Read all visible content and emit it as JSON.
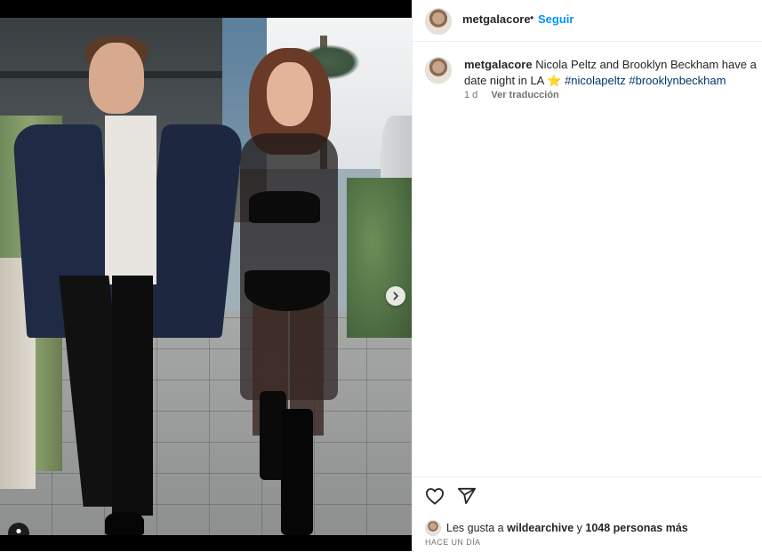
{
  "post": {
    "username": "metgalacore",
    "follow_label": "Seguir",
    "separator": "•",
    "caption_username": "metgalacore",
    "caption_text": "Nicola Peltz and Brooklyn Beckham have a date night in LA",
    "caption_emoji": "⭐",
    "hashtags": [
      "#nicolapeltz",
      "#brooklynbeckham"
    ],
    "age": "1 d",
    "translate_label": "Ver traducción",
    "likes_prefix": "Les gusta a",
    "likes_user": "wildearchive",
    "likes_join": "y",
    "likes_others": "1048 personas más",
    "timestamp": "HACE UN DÍA"
  },
  "media": {
    "slide_count": 2,
    "active_slide": 1,
    "next_icon": "chevron-right-icon",
    "tag_icon": "person-tag-icon"
  },
  "colors": {
    "link_blue": "#0095f6",
    "hashtag": "#00376b",
    "text": "#262626",
    "muted": "#737373"
  }
}
